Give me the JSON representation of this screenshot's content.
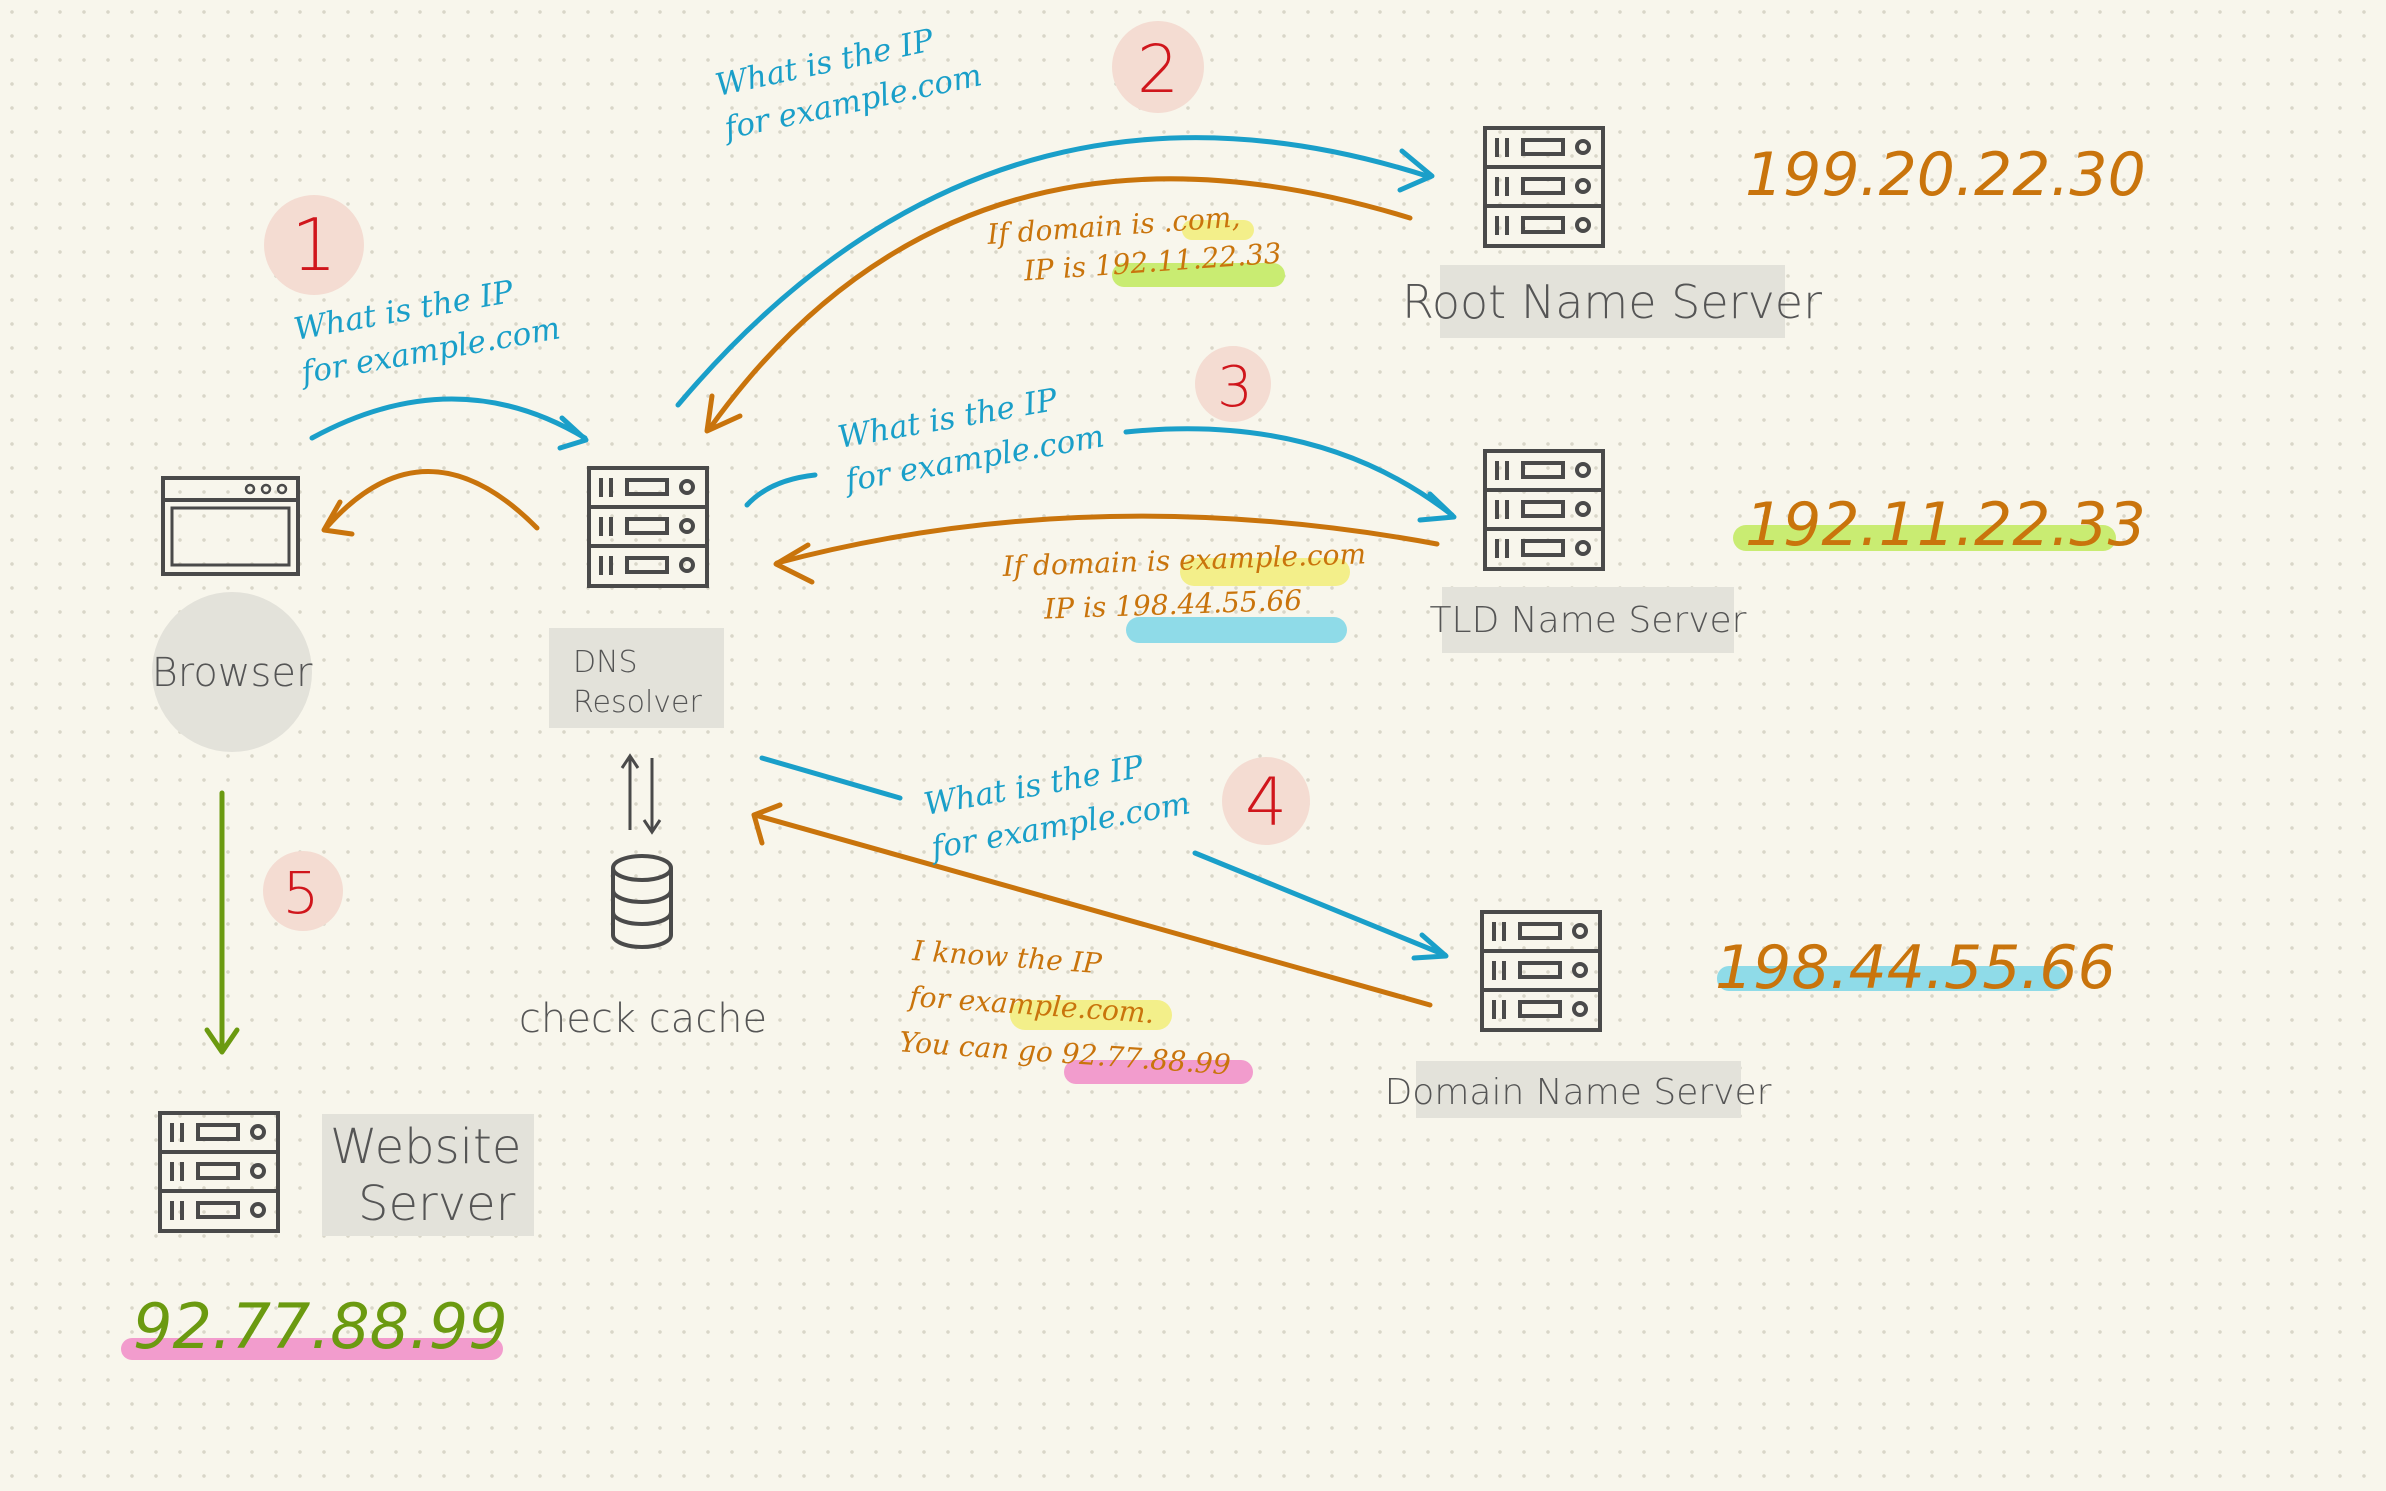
{
  "nodes": {
    "browser": {
      "label": "Browser"
    },
    "dns_resolver": {
      "label_line1": "DNS",
      "label_line2": "Resolver"
    },
    "cache": {
      "label": "check cache"
    },
    "root_server": {
      "label": "Root Name Server",
      "ip": "199.20.22.30"
    },
    "tld_server": {
      "label": "TLD Name Server",
      "ip": "192.11.22.33"
    },
    "domain_server": {
      "label": "Domain Name Server",
      "ip": "198.44.55.66"
    },
    "website_server": {
      "label_line1": "Website",
      "label_line2": "Server",
      "ip": "92.77.88.99"
    }
  },
  "steps": [
    "1",
    "2",
    "3",
    "4",
    "5"
  ],
  "queries": {
    "step1": {
      "line1": "What is the IP",
      "line2": "for example.com"
    },
    "step2": {
      "line1": "What is the IP",
      "line2": "for example.com"
    },
    "step3": {
      "line1": "What is the IP",
      "line2": "for example.com"
    },
    "step4": {
      "line1": "What is the IP",
      "line2": "for example.com"
    }
  },
  "responses": {
    "root": {
      "line1_prefix": "If domain is ",
      "line1_highlight": ".com",
      "line1_suffix": ",",
      "line2_prefix": "IP is ",
      "line2_highlight": "192.11.22.33"
    },
    "tld": {
      "line1_prefix": "If domain is ",
      "line1_highlight": "example.com",
      "line2_prefix": "IP is ",
      "line2_highlight": "198.44.55.66"
    },
    "domain": {
      "line1": "I know the IP",
      "line2_prefix": "for ",
      "line2_highlight": "example.com",
      "line2_suffix": ".",
      "line3_prefix": "You can go ",
      "line3_highlight": "92.77.88.99"
    }
  },
  "colors": {
    "query": "#1a9fc9",
    "response": "#c9740c",
    "step_number": "#d0161c",
    "step_circle": "#f4dcd2",
    "final_arrow": "#6b9a10",
    "highlight_yellow": "#f3ef8a",
    "highlight_green": "#c9ec72",
    "highlight_cyan": "#8fdbe8",
    "highlight_pink": "#f29ccd",
    "label_box": "#e3e2da"
  }
}
